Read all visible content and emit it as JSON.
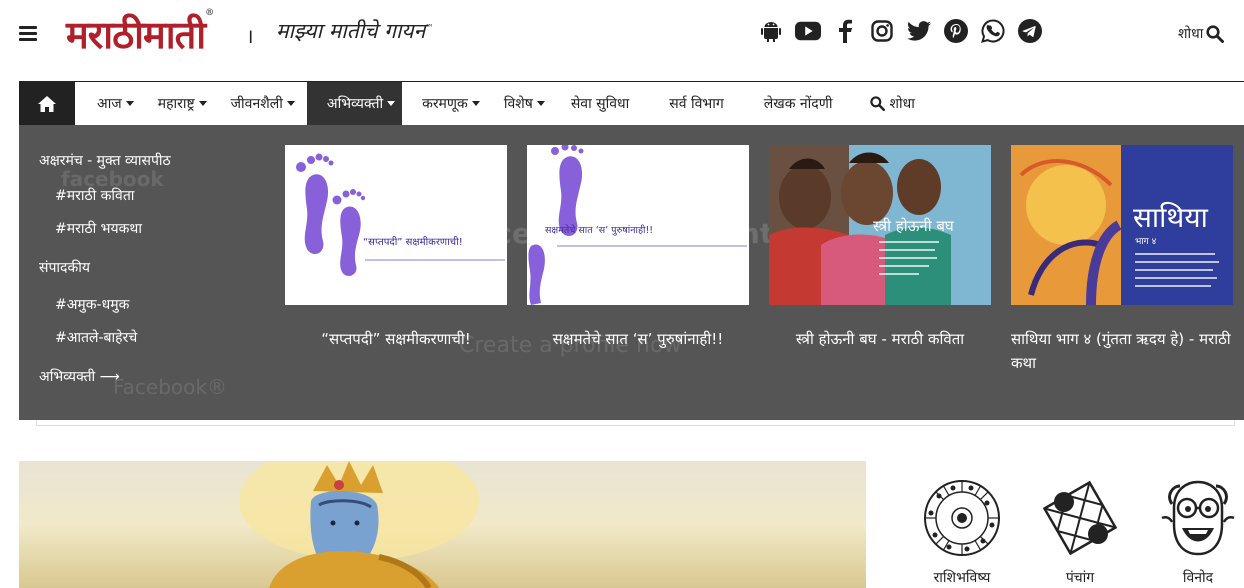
{
  "header": {
    "logo": "मराठीमाती",
    "logo_mark": "®",
    "separator": "।",
    "tagline": "माझ्या मातीचे गायन",
    "tagline_mark": "™",
    "search_label": "शोधा",
    "social_icons": [
      "android-icon",
      "youtube-icon",
      "facebook-icon",
      "instagram-icon",
      "twitter-icon",
      "pinterest-icon",
      "whatsapp-icon",
      "telegram-icon"
    ]
  },
  "nav": {
    "items": [
      {
        "label": "आज",
        "dropdown": true
      },
      {
        "label": "महाराष्ट्र",
        "dropdown": true
      },
      {
        "label": "जीवनशैली",
        "dropdown": true
      },
      {
        "label": "अभिव्यक्ती",
        "dropdown": true,
        "active": true
      },
      {
        "label": "करमणूक",
        "dropdown": true
      },
      {
        "label": "विशेष",
        "dropdown": true
      },
      {
        "label": "सेवा सुविधा",
        "dropdown": false
      },
      {
        "label": "सर्व विभाग",
        "dropdown": false
      },
      {
        "label": "लेखक नोंदणी",
        "dropdown": false
      }
    ],
    "search_label": "शोधा"
  },
  "mega_menu": {
    "sidebar": {
      "heading1": "अक्षरमंच - मुक्त व्यासपीठ",
      "sub1": "#मराठी कविता",
      "sub2": "#मराठी भयकथा",
      "heading2": "संपादकीय",
      "sub3": "#अमुक-धमुक",
      "sub4": "#आतले-बाहेरचे",
      "more": "अभिव्यक्ती ⟶"
    },
    "cards": [
      {
        "title": "“सप्तपदी” सक्षमीकरणाची!",
        "image_text": "“सप्तपदी” सक्षमीकरणाची!"
      },
      {
        "title": "सक्षमतेचे सात ‘स’ पुरुषांनाही!!",
        "image_text": "सक्षमतेचे सात ‘स’ पुरुषांनाही!!"
      },
      {
        "title": "स्त्री होऊनी बघ - मराठी कविता",
        "image_text": "स्त्री होऊनी बघ"
      },
      {
        "title": "साथिया भाग ४ (गुंतता ऋदय हे) - मराठी कथा",
        "image_text": "साथिया",
        "image_subtext": "भाग ४"
      }
    ],
    "ghost_text": {
      "fb1": "facebook",
      "fb2": "Facebook® Account Sign",
      "fb3": "Create a profile now",
      "fb4": "Facebook®"
    }
  },
  "services": [
    {
      "label": "राशिभविष्य",
      "icon": "zodiac-wheel-icon"
    },
    {
      "label": "पंचांग",
      "icon": "panchang-chart-icon"
    },
    {
      "label": "विनोद",
      "icon": "laughing-face-icon"
    }
  ],
  "colors": {
    "brand_red": "#b0202a",
    "nav_dark": "#222222",
    "mega_bg": "#555555",
    "active_nav": "#333333"
  }
}
